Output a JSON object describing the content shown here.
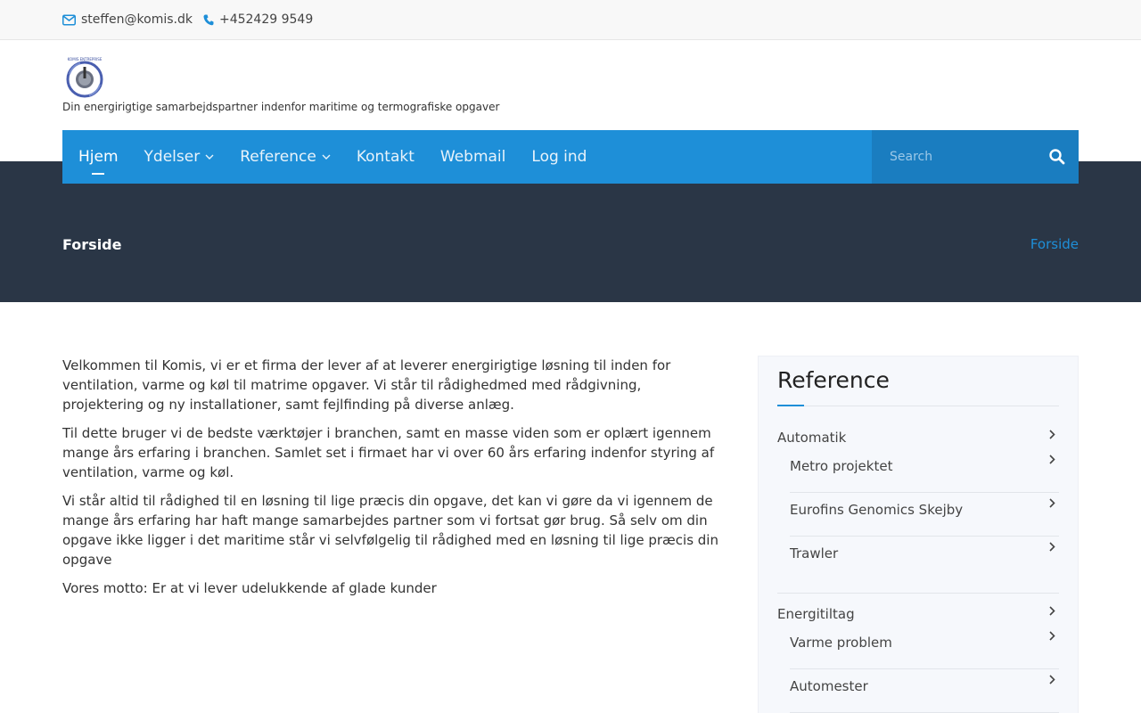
{
  "topbar": {
    "email": "steffen@komis.dk",
    "phone": "+452429 9549"
  },
  "header": {
    "logo_text": "KOMIS ENTREPRISE",
    "tagline": "Din energirigtige samarbejdspartner indenfor maritime og termografiske opgaver"
  },
  "nav": {
    "items": [
      {
        "label": "Hjem"
      },
      {
        "label": "Ydelser"
      },
      {
        "label": "Reference"
      },
      {
        "label": "Kontakt"
      },
      {
        "label": "Webmail"
      },
      {
        "label": "Log ind"
      }
    ],
    "search_placeholder": "Search"
  },
  "banner": {
    "title": "Forside",
    "breadcrumb": "Forside"
  },
  "main": {
    "paragraphs": [
      "Velkommen til Komis, vi er et firma der lever af at leverer energirigtige løsning til inden for ventilation, varme og køl til matrime opgaver. Vi står til rådighedmed med rådgivning, projektering og ny installationer, samt fejlfinding på diverse anlæg.",
      "Til dette bruger vi de bedste værktøjer i branchen, samt en masse viden som er oplært igennem mange års erfaring i branchen. Samlet set i firmaet har vi over 60 års erfaring indenfor styring af ventilation, varme og køl.",
      "Vi står altid til rådighed til en løsning til lige præcis din opgave,  det kan vi gøre da vi igennem de mange års erfaring har haft mange samarbejdes partner som vi fortsat gør brug. Så selv om din opgave ikke ligger i det maritime står vi selvfølgelig til rådighed med en løsning til lige præcis din opgave",
      "Vores motto: Er at vi lever udelukkende af glade kunder"
    ]
  },
  "sidebar": {
    "title": "Reference",
    "categories": [
      {
        "label": "Automatik",
        "items": [
          "Metro projektet",
          "Eurofins Genomics Skejby",
          "Trawler"
        ]
      },
      {
        "label": "Energitiltag",
        "items": [
          "Varme problem",
          "Automester"
        ]
      }
    ]
  },
  "colors": {
    "accent": "#1e8fd8",
    "banner": "#2a3646",
    "search_bg": "#1a7dc0"
  }
}
